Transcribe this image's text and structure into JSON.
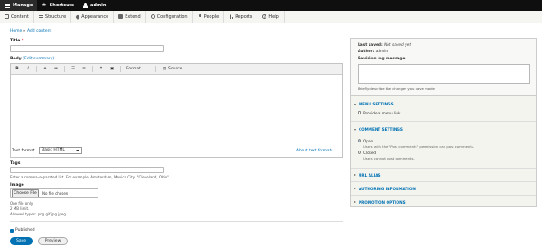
{
  "topbar": {
    "manage": "Manage",
    "shortcuts": "Shortcuts",
    "user": "admin"
  },
  "adminbar": {
    "items": [
      "Content",
      "Structure",
      "Appearance",
      "Extend",
      "Configuration",
      "People",
      "Reports",
      "Help"
    ]
  },
  "breadcrumb": {
    "home": "Home",
    "sep": "»",
    "current": "Add content"
  },
  "title_field": {
    "label": "Title",
    "required_mark": "*",
    "value": ""
  },
  "body_field": {
    "label": "Body",
    "summary_link": "(Edit summary)"
  },
  "toolbar": {
    "format_label": "Format",
    "source_label": "Source"
  },
  "text_format": {
    "label": "Text format",
    "selected": "Basic HTML",
    "about_link": "About text formats"
  },
  "tags": {
    "label": "Tags",
    "value": "",
    "help": "Enter a comma-separated list. For example: Amsterdam, Mexico City, \"Cleveland, Ohio\""
  },
  "image": {
    "label": "Image",
    "button": "Choose File",
    "status": "No file chosen",
    "help1": "One file only.",
    "help2": "2 MB limit.",
    "help3": "Allowed types: png gif jpg jpeg."
  },
  "published": {
    "label": "Published"
  },
  "buttons": {
    "save": "Save",
    "preview": "Preview"
  },
  "sidebar": {
    "last_saved_label": "Last saved:",
    "last_saved_value": "Not saved yet",
    "author_label": "Author:",
    "author_value": "admin",
    "revision_label": "Revision log message",
    "revision_help": "Briefly describe the changes you have made.",
    "menu": {
      "title": "MENU SETTINGS",
      "option": "Provide a menu link"
    },
    "comment": {
      "title": "COMMENT SETTINGS",
      "open_label": "Open",
      "open_desc": "Users with the \"Post comments\" permission can post comments.",
      "closed_label": "Closed",
      "closed_desc": "Users cannot post comments."
    },
    "url_alias": "URL ALIAS",
    "authoring": "AUTHORING INFORMATION",
    "promotion": "PROMOTION OPTIONS"
  }
}
